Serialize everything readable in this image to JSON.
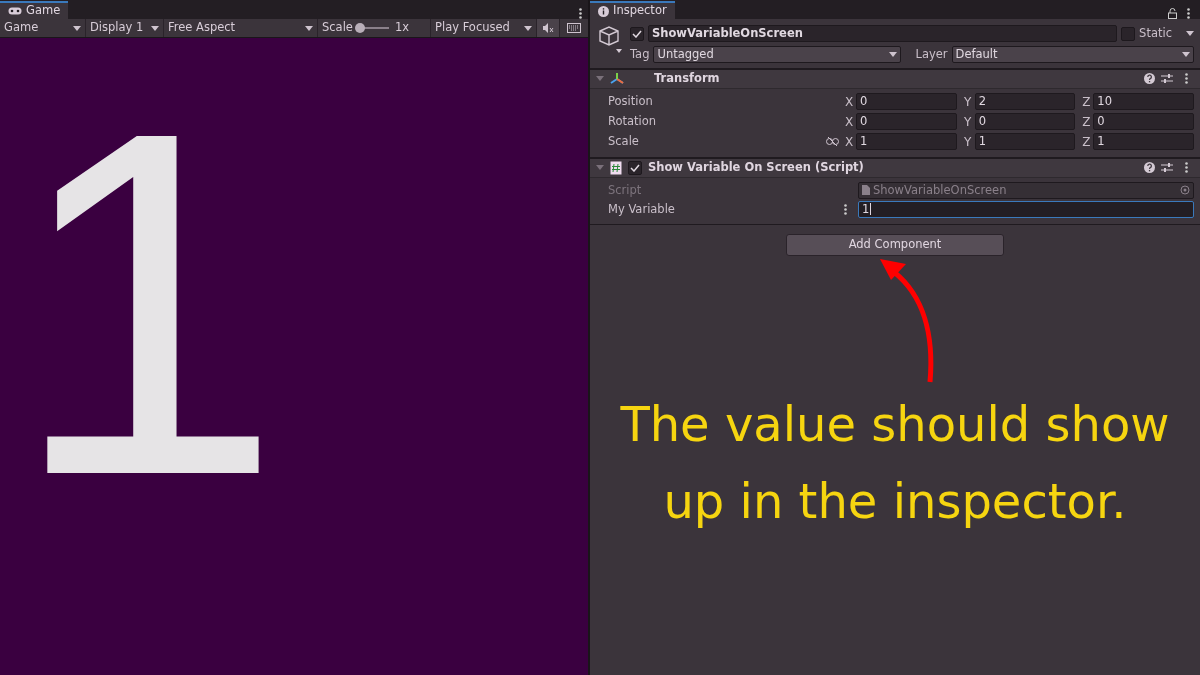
{
  "game_panel": {
    "tab": {
      "label": "Game",
      "selected": true
    },
    "toolbar": {
      "dropdowns": [
        "Game",
        "Display 1",
        "Free Aspect"
      ],
      "scale_label": "Scale",
      "scale_slider": {
        "level": 0.05
      },
      "scale_reading": "1x",
      "play_mode": "Play Focused"
    },
    "view": {
      "text": "1"
    }
  },
  "inspector": {
    "tab": {
      "label": "Inspector",
      "selected": true
    },
    "object": {
      "active": true,
      "name": "ShowVariableOnScreen",
      "static": false,
      "static_label": "Static",
      "tag_label": "Tag",
      "tag": "Untagged",
      "layer_label": "Layer",
      "layer": "Default"
    },
    "components": [
      {
        "kind": "transform",
        "title": "Transform",
        "expanded": true,
        "rows": [
          {
            "label": "Position",
            "linked": false,
            "values": [
              {
                "axis": "X",
                "value": "0"
              },
              {
                "axis": "Y",
                "value": "2"
              },
              {
                "axis": "Z",
                "value": "10"
              }
            ]
          },
          {
            "label": "Rotation",
            "linked": false,
            "values": [
              {
                "axis": "X",
                "value": "0"
              },
              {
                "axis": "Y",
                "value": "0"
              },
              {
                "axis": "Z",
                "value": "0"
              }
            ]
          },
          {
            "label": "Scale",
            "linked": true,
            "values": [
              {
                "axis": "X",
                "value": "1"
              },
              {
                "axis": "Y",
                "value": "1"
              },
              {
                "axis": "Z",
                "value": "1"
              }
            ]
          }
        ]
      },
      {
        "kind": "script",
        "title": "Show Variable On Screen (Script)",
        "expanded": true,
        "enabled": true,
        "fields": [
          {
            "kind": "object",
            "label": "Script",
            "value": "ShowVariableOnScreen",
            "disabled": true,
            "focused": false
          },
          {
            "kind": "number",
            "label": "My Variable",
            "value": "1",
            "disabled": false,
            "focused": true
          }
        ]
      }
    ],
    "add_button": "Add Component"
  },
  "annotation": {
    "lines": [
      "The value should show",
      "up in the inspector."
    ]
  }
}
